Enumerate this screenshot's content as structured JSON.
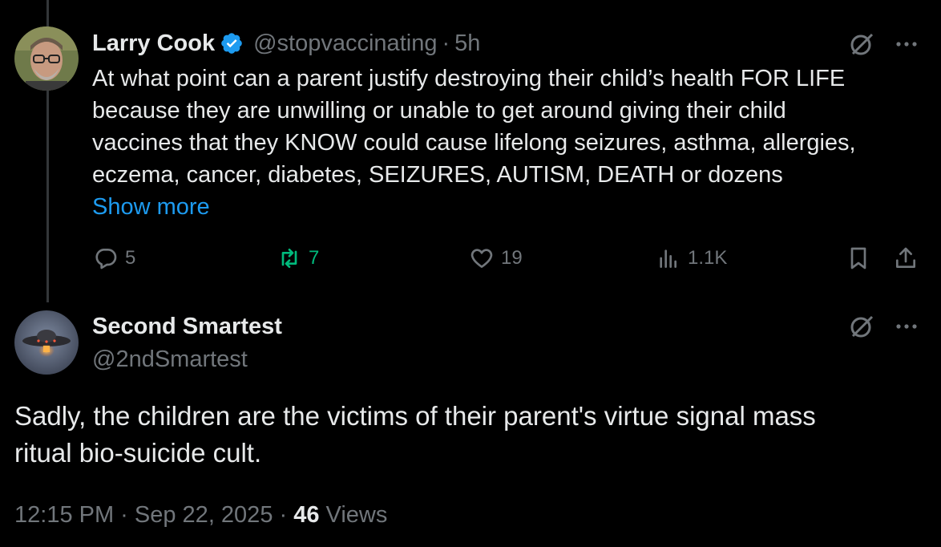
{
  "colors": {
    "background": "#000000",
    "text_primary": "#e7e9ea",
    "text_secondary": "#71767b",
    "link": "#1d9bf0",
    "verified": "#1d9bf0",
    "retweet": "#00ba7c",
    "thread_line": "#333639"
  },
  "original_tweet": {
    "author_name": "Larry Cook",
    "verified": true,
    "handle": "@stopvaccinating",
    "separator": "·",
    "time_ago": "5h",
    "text_lines": [
      "At what point can a parent justify destroying their child’s health FOR LIFE",
      "because they are unwilling or unable to get around giving their child",
      "vaccines that they KNOW could cause lifelong seizures, asthma, allergies,",
      "eczema, cancer, diabetes, SEIZURES, AUTISM, DEATH or dozens"
    ],
    "show_more_label": "Show more",
    "actions": {
      "replies": "5",
      "reposts": "7",
      "likes": "19",
      "views": "1.1K"
    },
    "icons": [
      "verified-badge-icon",
      "grok-icon",
      "more-icon",
      "reply-icon",
      "repost-icon",
      "like-icon",
      "views-icon",
      "bookmark-icon",
      "share-icon"
    ]
  },
  "reply_tweet": {
    "author_name": "Second Smartest",
    "handle": "@2ndSmartest",
    "text_lines": [
      "Sadly, the children are the victims of their parent's virtue signal mass",
      "ritual bio-suicide cult."
    ],
    "timestamp": "12:15 PM · Sep 22, 2025 · ",
    "views_count": "46",
    "views_label": " Views",
    "icons": [
      "grok-icon",
      "more-icon"
    ]
  }
}
